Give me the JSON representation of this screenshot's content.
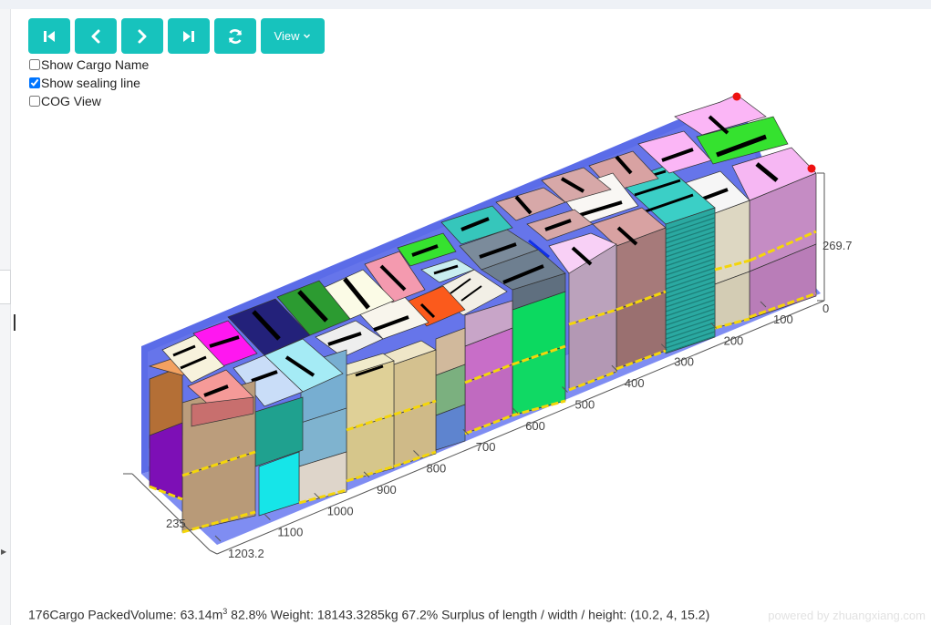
{
  "toolbar": {
    "buttons": [
      {
        "id": "first",
        "icon": "skip-first-icon"
      },
      {
        "id": "prev",
        "icon": "chevron-left-icon"
      },
      {
        "id": "next",
        "icon": "chevron-right-icon"
      },
      {
        "id": "last",
        "icon": "skip-last-icon"
      },
      {
        "id": "refresh",
        "icon": "refresh-icon"
      }
    ],
    "view_label": "View",
    "accent": "#17c3bd"
  },
  "options": {
    "show_cargo_name": {
      "label": "Show Cargo Name",
      "checked": false
    },
    "show_sealing_line": {
      "label": "Show sealing line",
      "checked": true
    },
    "cog_view": {
      "label": "COG View",
      "checked": false
    }
  },
  "axes": {
    "height_value": "269.7",
    "height_zero": "0",
    "width_value": "235",
    "length_ticks": [
      "100",
      "200",
      "300",
      "400",
      "500",
      "600",
      "700",
      "800",
      "900",
      "1000",
      "1100",
      "1203.2"
    ]
  },
  "status": {
    "cargo_count": "176Cargo",
    "packed_volume": "PackedVolume: 63.14m",
    "volume_exponent": "3",
    "rest": " 82.8% Weight: 18143.3285kg 67.2% Surplus of length / width / height: (10.2, 4, 15.2)"
  },
  "powered_by": "powered by zhuangxiang.com"
}
